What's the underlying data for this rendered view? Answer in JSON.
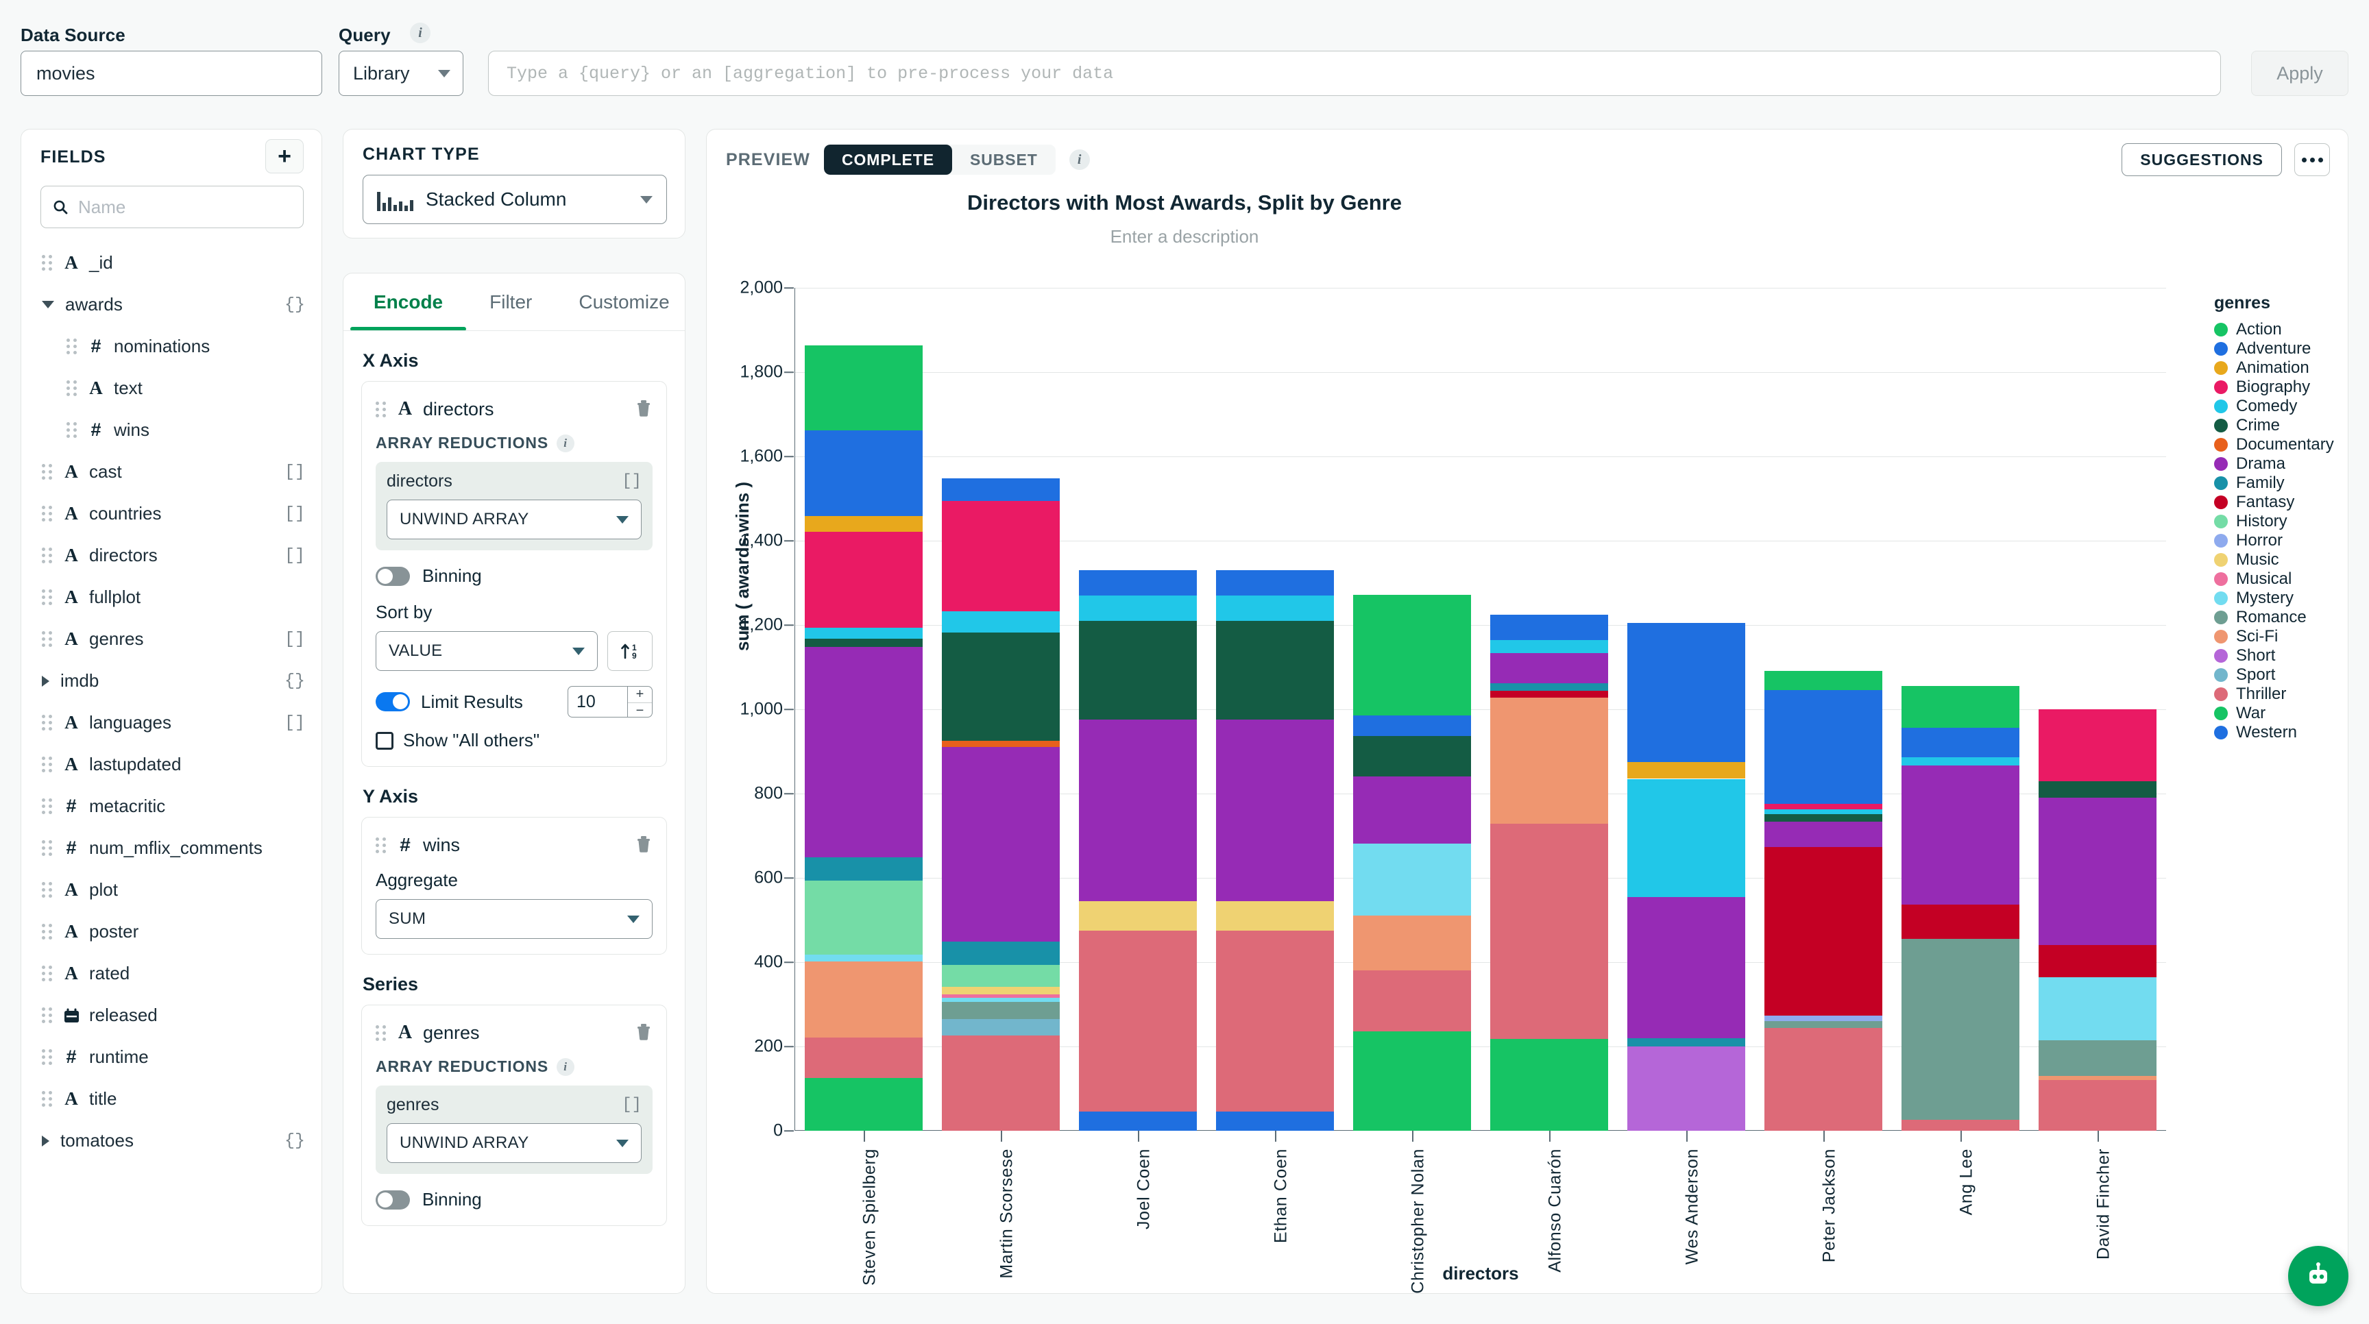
{
  "topbar": {
    "data_source_label": "Data Source",
    "data_source_value": "movies",
    "query_label": "Query",
    "query_mode": "Library",
    "query_placeholder": "Type a {query} or an [aggregation] to pre-process your data",
    "query_value": "",
    "apply_label": "Apply"
  },
  "fields": {
    "title": "FIELDS",
    "add_label": "+",
    "search_placeholder": "Name",
    "items": [
      {
        "name": "_id",
        "type": "A",
        "level": 0,
        "badge": ""
      },
      {
        "name": "awards",
        "type": "group-open",
        "level": 0,
        "badge": "{}"
      },
      {
        "name": "nominations",
        "type": "#",
        "level": 1,
        "badge": ""
      },
      {
        "name": "text",
        "type": "A",
        "level": 1,
        "badge": ""
      },
      {
        "name": "wins",
        "type": "#",
        "level": 1,
        "badge": ""
      },
      {
        "name": "cast",
        "type": "A",
        "level": 0,
        "badge": "[]"
      },
      {
        "name": "countries",
        "type": "A",
        "level": 0,
        "badge": "[]"
      },
      {
        "name": "directors",
        "type": "A",
        "level": 0,
        "badge": "[]"
      },
      {
        "name": "fullplot",
        "type": "A",
        "level": 0,
        "badge": ""
      },
      {
        "name": "genres",
        "type": "A",
        "level": 0,
        "badge": "[]"
      },
      {
        "name": "imdb",
        "type": "group-closed",
        "level": 0,
        "badge": "{}"
      },
      {
        "name": "languages",
        "type": "A",
        "level": 0,
        "badge": "[]"
      },
      {
        "name": "lastupdated",
        "type": "A",
        "level": 0,
        "badge": ""
      },
      {
        "name": "metacritic",
        "type": "#",
        "level": 0,
        "badge": ""
      },
      {
        "name": "num_mflix_comments",
        "type": "#",
        "level": 0,
        "badge": ""
      },
      {
        "name": "plot",
        "type": "A",
        "level": 0,
        "badge": ""
      },
      {
        "name": "poster",
        "type": "A",
        "level": 0,
        "badge": ""
      },
      {
        "name": "rated",
        "type": "A",
        "level": 0,
        "badge": ""
      },
      {
        "name": "released",
        "type": "date",
        "level": 0,
        "badge": ""
      },
      {
        "name": "runtime",
        "type": "#",
        "level": 0,
        "badge": ""
      },
      {
        "name": "title",
        "type": "A",
        "level": 0,
        "badge": ""
      },
      {
        "name": "tomatoes",
        "type": "group-closed",
        "level": 0,
        "badge": "{}"
      }
    ]
  },
  "chart_type": {
    "title": "CHART TYPE",
    "value": "Stacked Column"
  },
  "encode": {
    "tabs": [
      {
        "label": "Encode",
        "active": true
      },
      {
        "label": "Filter",
        "active": false
      },
      {
        "label": "Customize",
        "active": false
      }
    ],
    "x_axis": {
      "section_label": "X Axis",
      "field": "directors",
      "field_type": "A",
      "array_reductions_label": "ARRAY REDUCTIONS",
      "reduction_field": "directors",
      "reduction_badge": "[]",
      "reduction_value": "UNWIND ARRAY",
      "binning_label": "Binning",
      "binning_on": false,
      "sort_label": "Sort by",
      "sort_value": "VALUE",
      "sort_direction": "ascending",
      "limit_label": "Limit Results",
      "limit_on": true,
      "limit_value": "10",
      "show_all_others_label": "Show \"All others\"",
      "show_all_others_checked": false
    },
    "y_axis": {
      "section_label": "Y Axis",
      "field": "wins",
      "field_type": "#",
      "aggregate_label": "Aggregate",
      "aggregate_value": "SUM"
    },
    "series": {
      "section_label": "Series",
      "field": "genres",
      "field_type": "A",
      "array_reductions_label": "ARRAY REDUCTIONS",
      "reduction_field": "genres",
      "reduction_badge": "[]",
      "reduction_value": "UNWIND ARRAY",
      "binning_label": "Binning",
      "binning_on": false
    }
  },
  "preview": {
    "label": "PREVIEW",
    "modes": [
      {
        "label": "COMPLETE",
        "active": true
      },
      {
        "label": "SUBSET",
        "active": false
      }
    ],
    "suggestions_label": "SUGGESTIONS",
    "more_label": "•••"
  },
  "chart_data": {
    "type": "bar",
    "stacked": true,
    "title": "Directors with Most Awards, Split by Genre",
    "subtitle": "Enter a description",
    "xlabel": "directors",
    "ylabel": "sum ( awards.wins )",
    "ylim": [
      0,
      2000
    ],
    "yticks": [
      0,
      200,
      400,
      600,
      800,
      1000,
      1200,
      1400,
      1600,
      1800,
      2000
    ],
    "ytick_labels": [
      "0",
      "200",
      "400",
      "600",
      "800",
      "1,000",
      "1,200",
      "1,400",
      "1,600",
      "1,800",
      "2,000"
    ],
    "grid": true,
    "legend_position": "right",
    "legend_title": "genres",
    "categories": [
      "Steven Spielberg",
      "Martin Scorsese",
      "Joel Coen",
      "Ethan Coen",
      "Christopher Nolan",
      "Alfonso Cuarón",
      "Wes Anderson",
      "Peter Jackson",
      "Ang Lee",
      "David Fincher"
    ],
    "totals": [
      1863,
      1548,
      1330,
      1330,
      1271,
      1224,
      1205,
      1091,
      1056,
      1000
    ],
    "genres": [
      {
        "name": "Action",
        "color": "#16c464"
      },
      {
        "name": "Adventure",
        "color": "#1f6fe0"
      },
      {
        "name": "Animation",
        "color": "#e8a81c"
      },
      {
        "name": "Biography",
        "color": "#ea1a64"
      },
      {
        "name": "Comedy",
        "color": "#21c7e8"
      },
      {
        "name": "Crime",
        "color": "#145c44"
      },
      {
        "name": "Documentary",
        "color": "#e8601c"
      },
      {
        "name": "Drama",
        "color": "#962bb5"
      },
      {
        "name": "Family",
        "color": "#1891a8"
      },
      {
        "name": "Fantasy",
        "color": "#c40024"
      },
      {
        "name": "History",
        "color": "#74dca6"
      },
      {
        "name": "Horror",
        "color": "#8eaaee"
      },
      {
        "name": "Music",
        "color": "#efd272"
      },
      {
        "name": "Musical",
        "color": "#ee6f9e"
      },
      {
        "name": "Mystery",
        "color": "#72dcf0"
      },
      {
        "name": "Romance",
        "color": "#6e9e92"
      },
      {
        "name": "Sci-Fi",
        "color": "#ef9670"
      },
      {
        "name": "Short",
        "color": "#b566d8"
      },
      {
        "name": "Sport",
        "color": "#72b6cc"
      },
      {
        "name": "Thriller",
        "color": "#dd6a78"
      },
      {
        "name": "War",
        "color": "#16c464"
      },
      {
        "name": "Western",
        "color": "#1f6fe0"
      }
    ],
    "series": [
      {
        "name": "Steven Spielberg",
        "segments": [
          {
            "genre": "Action",
            "value": 190
          },
          {
            "genre": "Adventure",
            "value": 190
          },
          {
            "genre": "Animation",
            "value": 35
          },
          {
            "genre": "Biography",
            "value": 215
          },
          {
            "genre": "Comedy",
            "value": 25
          },
          {
            "genre": "Crime",
            "value": 18
          },
          {
            "genre": "Drama",
            "value": 470
          },
          {
            "genre": "Family",
            "value": 52
          },
          {
            "genre": "History",
            "value": 165
          },
          {
            "genre": "Mystery",
            "value": 15
          },
          {
            "genre": "Sci-Fi",
            "value": 170
          },
          {
            "genre": "Thriller",
            "value": 90
          },
          {
            "genre": "War",
            "value": 118
          }
        ]
      },
      {
        "name": "Martin Scorsese",
        "segments": [
          {
            "genre": "Adventure",
            "value": 52
          },
          {
            "genre": "Biography",
            "value": 255
          },
          {
            "genre": "Comedy",
            "value": 50
          },
          {
            "genre": "Crime",
            "value": 250
          },
          {
            "genre": "Documentary",
            "value": 14
          },
          {
            "genre": "Drama",
            "value": 450
          },
          {
            "genre": "Family",
            "value": 55
          },
          {
            "genre": "History",
            "value": 50
          },
          {
            "genre": "Music",
            "value": 17
          },
          {
            "genre": "Musical",
            "value": 8
          },
          {
            "genre": "Mystery",
            "value": 10
          },
          {
            "genre": "Romance",
            "value": 40
          },
          {
            "genre": "Sport",
            "value": 38
          },
          {
            "genre": "Thriller",
            "value": 220
          }
        ]
      },
      {
        "name": "Joel Coen",
        "segments": [
          {
            "genre": "Adventure",
            "value": 60
          },
          {
            "genre": "Comedy",
            "value": 60
          },
          {
            "genre": "Crime",
            "value": 235
          },
          {
            "genre": "Drama",
            "value": 430
          },
          {
            "genre": "Music",
            "value": 70
          },
          {
            "genre": "Thriller",
            "value": 430
          },
          {
            "genre": "Western",
            "value": 45
          }
        ]
      },
      {
        "name": "Ethan Coen",
        "segments": [
          {
            "genre": "Adventure",
            "value": 60
          },
          {
            "genre": "Comedy",
            "value": 60
          },
          {
            "genre": "Crime",
            "value": 235
          },
          {
            "genre": "Drama",
            "value": 430
          },
          {
            "genre": "Music",
            "value": 70
          },
          {
            "genre": "Thriller",
            "value": 430
          },
          {
            "genre": "Western",
            "value": 45
          }
        ]
      },
      {
        "name": "Christopher Nolan",
        "segments": [
          {
            "genre": "Action",
            "value": 285
          },
          {
            "genre": "Adventure",
            "value": 50
          },
          {
            "genre": "Crime",
            "value": 95
          },
          {
            "genre": "Drama",
            "value": 160
          },
          {
            "genre": "Mystery",
            "value": 170
          },
          {
            "genre": "Sci-Fi",
            "value": 130
          },
          {
            "genre": "Thriller",
            "value": 145
          },
          {
            "genre": "War",
            "value": 236
          }
        ]
      },
      {
        "name": "Alfonso Cuarón",
        "segments": [
          {
            "genre": "Adventure",
            "value": 60
          },
          {
            "genre": "Comedy",
            "value": 30
          },
          {
            "genre": "Drama",
            "value": 72
          },
          {
            "genre": "Family",
            "value": 18
          },
          {
            "genre": "Fantasy",
            "value": 16
          },
          {
            "genre": "Sci-Fi",
            "value": 300
          },
          {
            "genre": "Thriller",
            "value": 510
          },
          {
            "genre": "War",
            "value": 218
          }
        ]
      },
      {
        "name": "Wes Anderson",
        "segments": [
          {
            "genre": "Adventure",
            "value": 330
          },
          {
            "genre": "Animation",
            "value": 40
          },
          {
            "genre": "Comedy",
            "value": 280
          },
          {
            "genre": "Drama",
            "value": 335
          },
          {
            "genre": "Family",
            "value": 20
          },
          {
            "genre": "Short",
            "value": 200
          }
        ]
      },
      {
        "name": "Peter Jackson",
        "segments": [
          {
            "genre": "Action",
            "value": 45
          },
          {
            "genre": "Adventure",
            "value": 270
          },
          {
            "genre": "Biography",
            "value": 14
          },
          {
            "genre": "Comedy",
            "value": 10
          },
          {
            "genre": "Crime",
            "value": 18
          },
          {
            "genre": "Drama",
            "value": 60
          },
          {
            "genre": "Fantasy",
            "value": 400
          },
          {
            "genre": "Horror",
            "value": 14
          },
          {
            "genre": "Romance",
            "value": 16
          },
          {
            "genre": "Thriller",
            "value": 244
          }
        ]
      },
      {
        "name": "Ang Lee",
        "segments": [
          {
            "genre": "Action",
            "value": 100
          },
          {
            "genre": "Adventure",
            "value": 70
          },
          {
            "genre": "Comedy",
            "value": 20
          },
          {
            "genre": "Drama",
            "value": 330
          },
          {
            "genre": "Fantasy",
            "value": 80
          },
          {
            "genre": "Romance",
            "value": 430
          },
          {
            "genre": "Thriller",
            "value": 26
          }
        ]
      },
      {
        "name": "David Fincher",
        "segments": [
          {
            "genre": "Biography",
            "value": 170
          },
          {
            "genre": "Crime",
            "value": 40
          },
          {
            "genre": "Drama",
            "value": 350
          },
          {
            "genre": "Fantasy",
            "value": 75
          },
          {
            "genre": "Mystery",
            "value": 150
          },
          {
            "genre": "Romance",
            "value": 85
          },
          {
            "genre": "Sci-Fi",
            "value": 10
          },
          {
            "genre": "Thriller",
            "value": 120
          }
        ]
      }
    ]
  },
  "fab": {
    "label": "assistant-icon"
  }
}
